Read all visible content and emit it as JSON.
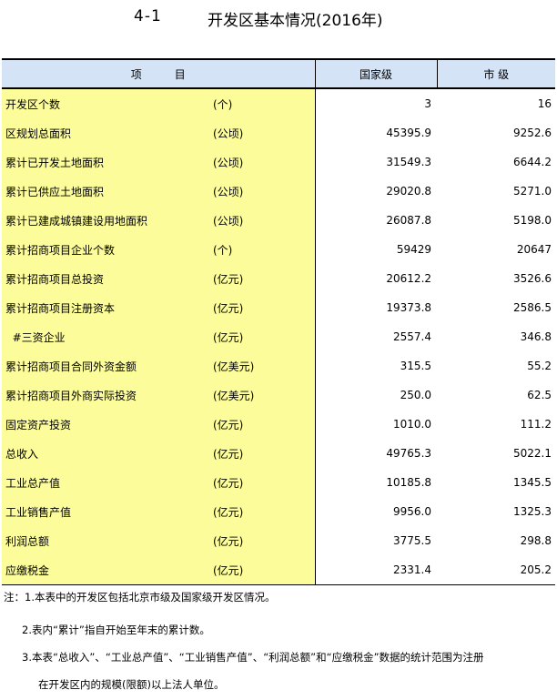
{
  "title": {
    "number": "4-1",
    "text": "开发区基本情况(2016年)"
  },
  "table": {
    "headers": {
      "item": "项目",
      "national": "国家级",
      "municipal": "市 级"
    },
    "rows": [
      {
        "name": "开发区个数",
        "unit": "(个)",
        "national": "3",
        "municipal": "16"
      },
      {
        "name": "区规划总面积",
        "unit": "(公顷)",
        "national": "45395.9",
        "municipal": "9252.6"
      },
      {
        "name": "累计已开发土地面积",
        "unit": "(公顷)",
        "national": "31549.3",
        "municipal": "6644.2"
      },
      {
        "name": "累计已供应土地面积",
        "unit": "(公顷)",
        "national": "29020.8",
        "municipal": "5271.0"
      },
      {
        "name": "累计已建成城镇建设用地面积",
        "unit": "(公顷)",
        "national": "26087.8",
        "municipal": "5198.0"
      },
      {
        "name": "累计招商项目企业个数",
        "unit": "(个)",
        "national": "59429",
        "municipal": "20647"
      },
      {
        "name": "累计招商项目总投资",
        "unit": "(亿元)",
        "national": "20612.2",
        "municipal": "3526.6"
      },
      {
        "name": "累计招商项目注册资本",
        "unit": "(亿元)",
        "national": "19373.8",
        "municipal": "2586.5"
      },
      {
        "name": "  #三资企业",
        "unit": "(亿元)",
        "national": "2557.4",
        "municipal": "346.8"
      },
      {
        "name": "累计招商项目合同外资金额",
        "unit": "(亿美元)",
        "national": "315.5",
        "municipal": "55.2"
      },
      {
        "name": "累计招商项目外商实际投资",
        "unit": "(亿美元)",
        "national": "250.0",
        "municipal": "62.5"
      },
      {
        "name": "固定资产投资",
        "unit": "(亿元)",
        "national": "1010.0",
        "municipal": "111.2"
      },
      {
        "name": "总收入",
        "unit": "(亿元)",
        "national": "49765.3",
        "municipal": "5022.1"
      },
      {
        "name": "工业总产值",
        "unit": "(亿元)",
        "national": "10185.8",
        "municipal": "1345.5"
      },
      {
        "name": "工业销售产值",
        "unit": "(亿元)",
        "national": "9956.0",
        "municipal": "1325.3"
      },
      {
        "name": "利润总额",
        "unit": "(亿元)",
        "national": "3775.5",
        "municipal": "298.8"
      },
      {
        "name": "应缴税金",
        "unit": "(亿元)",
        "national": "2331.4",
        "municipal": "205.2"
      }
    ]
  },
  "notes": {
    "line1": "注：1.本表中的开发区包括北京市级及国家级开发区情况。",
    "line2": "2.表内“累计”指自开始至年末的累计数。",
    "line3": "3.本表“总收入”、“工业总产值”、“工业销售产值”、“利润总额”和“应缴税金”数据的统计范围为注册",
    "line4": "在开发区内的规模(限额)以上法人单位。"
  }
}
